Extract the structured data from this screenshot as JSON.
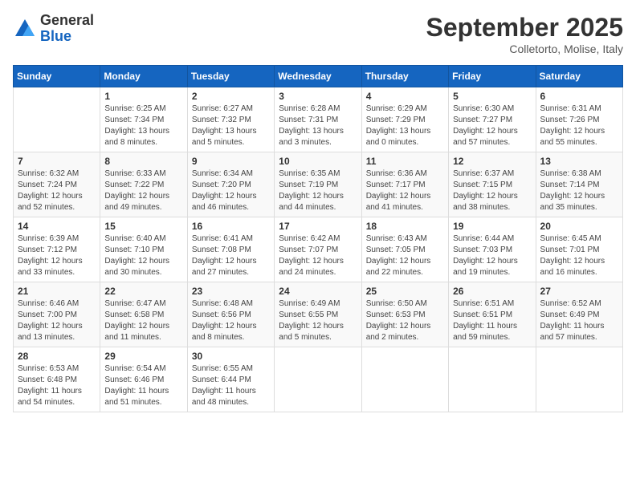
{
  "header": {
    "logo_general": "General",
    "logo_blue": "Blue",
    "month_year": "September 2025",
    "location": "Colletorto, Molise, Italy"
  },
  "days_of_week": [
    "Sunday",
    "Monday",
    "Tuesday",
    "Wednesday",
    "Thursday",
    "Friday",
    "Saturday"
  ],
  "weeks": [
    [
      {
        "day": "",
        "info": ""
      },
      {
        "day": "1",
        "info": "Sunrise: 6:25 AM\nSunset: 7:34 PM\nDaylight: 13 hours\nand 8 minutes."
      },
      {
        "day": "2",
        "info": "Sunrise: 6:27 AM\nSunset: 7:32 PM\nDaylight: 13 hours\nand 5 minutes."
      },
      {
        "day": "3",
        "info": "Sunrise: 6:28 AM\nSunset: 7:31 PM\nDaylight: 13 hours\nand 3 minutes."
      },
      {
        "day": "4",
        "info": "Sunrise: 6:29 AM\nSunset: 7:29 PM\nDaylight: 13 hours\nand 0 minutes."
      },
      {
        "day": "5",
        "info": "Sunrise: 6:30 AM\nSunset: 7:27 PM\nDaylight: 12 hours\nand 57 minutes."
      },
      {
        "day": "6",
        "info": "Sunrise: 6:31 AM\nSunset: 7:26 PM\nDaylight: 12 hours\nand 55 minutes."
      }
    ],
    [
      {
        "day": "7",
        "info": "Sunrise: 6:32 AM\nSunset: 7:24 PM\nDaylight: 12 hours\nand 52 minutes."
      },
      {
        "day": "8",
        "info": "Sunrise: 6:33 AM\nSunset: 7:22 PM\nDaylight: 12 hours\nand 49 minutes."
      },
      {
        "day": "9",
        "info": "Sunrise: 6:34 AM\nSunset: 7:20 PM\nDaylight: 12 hours\nand 46 minutes."
      },
      {
        "day": "10",
        "info": "Sunrise: 6:35 AM\nSunset: 7:19 PM\nDaylight: 12 hours\nand 44 minutes."
      },
      {
        "day": "11",
        "info": "Sunrise: 6:36 AM\nSunset: 7:17 PM\nDaylight: 12 hours\nand 41 minutes."
      },
      {
        "day": "12",
        "info": "Sunrise: 6:37 AM\nSunset: 7:15 PM\nDaylight: 12 hours\nand 38 minutes."
      },
      {
        "day": "13",
        "info": "Sunrise: 6:38 AM\nSunset: 7:14 PM\nDaylight: 12 hours\nand 35 minutes."
      }
    ],
    [
      {
        "day": "14",
        "info": "Sunrise: 6:39 AM\nSunset: 7:12 PM\nDaylight: 12 hours\nand 33 minutes."
      },
      {
        "day": "15",
        "info": "Sunrise: 6:40 AM\nSunset: 7:10 PM\nDaylight: 12 hours\nand 30 minutes."
      },
      {
        "day": "16",
        "info": "Sunrise: 6:41 AM\nSunset: 7:08 PM\nDaylight: 12 hours\nand 27 minutes."
      },
      {
        "day": "17",
        "info": "Sunrise: 6:42 AM\nSunset: 7:07 PM\nDaylight: 12 hours\nand 24 minutes."
      },
      {
        "day": "18",
        "info": "Sunrise: 6:43 AM\nSunset: 7:05 PM\nDaylight: 12 hours\nand 22 minutes."
      },
      {
        "day": "19",
        "info": "Sunrise: 6:44 AM\nSunset: 7:03 PM\nDaylight: 12 hours\nand 19 minutes."
      },
      {
        "day": "20",
        "info": "Sunrise: 6:45 AM\nSunset: 7:01 PM\nDaylight: 12 hours\nand 16 minutes."
      }
    ],
    [
      {
        "day": "21",
        "info": "Sunrise: 6:46 AM\nSunset: 7:00 PM\nDaylight: 12 hours\nand 13 minutes."
      },
      {
        "day": "22",
        "info": "Sunrise: 6:47 AM\nSunset: 6:58 PM\nDaylight: 12 hours\nand 11 minutes."
      },
      {
        "day": "23",
        "info": "Sunrise: 6:48 AM\nSunset: 6:56 PM\nDaylight: 12 hours\nand 8 minutes."
      },
      {
        "day": "24",
        "info": "Sunrise: 6:49 AM\nSunset: 6:55 PM\nDaylight: 12 hours\nand 5 minutes."
      },
      {
        "day": "25",
        "info": "Sunrise: 6:50 AM\nSunset: 6:53 PM\nDaylight: 12 hours\nand 2 minutes."
      },
      {
        "day": "26",
        "info": "Sunrise: 6:51 AM\nSunset: 6:51 PM\nDaylight: 11 hours\nand 59 minutes."
      },
      {
        "day": "27",
        "info": "Sunrise: 6:52 AM\nSunset: 6:49 PM\nDaylight: 11 hours\nand 57 minutes."
      }
    ],
    [
      {
        "day": "28",
        "info": "Sunrise: 6:53 AM\nSunset: 6:48 PM\nDaylight: 11 hours\nand 54 minutes."
      },
      {
        "day": "29",
        "info": "Sunrise: 6:54 AM\nSunset: 6:46 PM\nDaylight: 11 hours\nand 51 minutes."
      },
      {
        "day": "30",
        "info": "Sunrise: 6:55 AM\nSunset: 6:44 PM\nDaylight: 11 hours\nand 48 minutes."
      },
      {
        "day": "",
        "info": ""
      },
      {
        "day": "",
        "info": ""
      },
      {
        "day": "",
        "info": ""
      },
      {
        "day": "",
        "info": ""
      }
    ]
  ]
}
